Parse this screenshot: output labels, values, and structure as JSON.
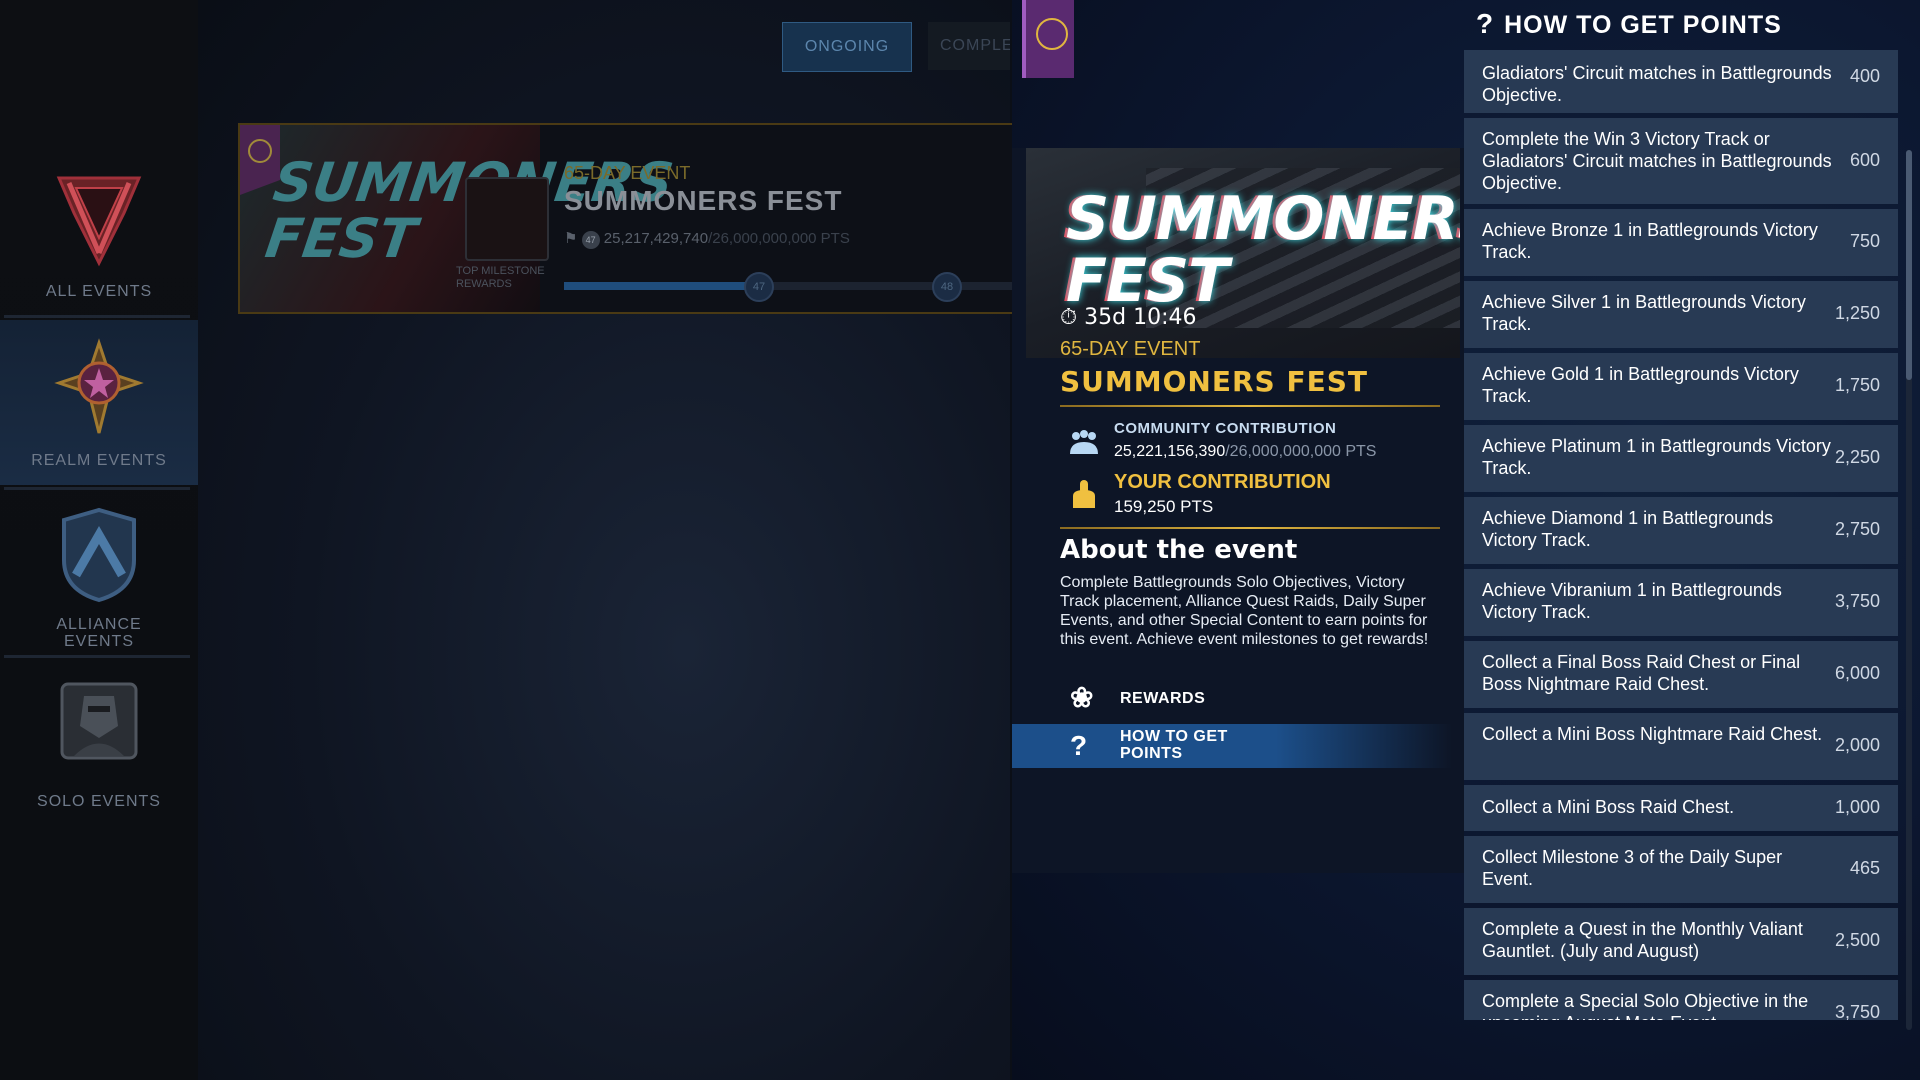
{
  "sidebar": {
    "items": [
      {
        "label": "ALL EVENTS",
        "icon": "all-events-icon"
      },
      {
        "label": "REALM EVENTS",
        "icon": "realm-events-icon"
      },
      {
        "label": "ALLIANCE EVENTS",
        "icon": "alliance-events-icon"
      },
      {
        "label": "SOLO EVENTS",
        "icon": "solo-events-icon"
      }
    ]
  },
  "tabs": {
    "ongoing": "ONGOING",
    "completed": "COMPLE"
  },
  "event_card": {
    "art_text": "SUMMONERS FEST",
    "type": "65-DAY EVENT",
    "title": "SUMMONERS FEST",
    "badge": "47",
    "points": "25,217,429,740",
    "points_max": "/26,000,000,000 PTS",
    "milestone_label": "TOP MILESTONE REWARDS",
    "progress": 0.44,
    "node_a": "47",
    "node_b": "48"
  },
  "detail": {
    "hero_text": "SUMMONERS FEST",
    "timer": "35d 10:46",
    "type": "65-DAY EVENT",
    "title": "SUMMONERS FEST",
    "community_label": "COMMUNITY CONTRIBUTION",
    "community_value": "25,221,156,390",
    "community_max": "/26,000,000,000 PTS",
    "your_label": "YOUR CONTRIBUTION",
    "your_value": "159,250 PTS",
    "about_title": "About the event",
    "about_text": "Complete Battlegrounds Solo Objectives, Victory Track placement, Alliance Quest Raids, Daily Super Events, and other Special Content to earn points for this event. Achieve event milestones to get rewards!",
    "nav_rewards": "REWARDS",
    "nav_htp": "HOW TO GET POINTS"
  },
  "how_to_get_points": {
    "title": "HOW TO GET POINTS",
    "rows": [
      {
        "desc": "Gladiators' Circuit matches in Battlegrounds Objective.",
        "pts": "400"
      },
      {
        "desc": "Complete the Win 3 Victory Track or Gladiators' Circuit matches in Battlegrounds Objective.",
        "pts": "600"
      },
      {
        "desc": "Achieve Bronze 1 in Battlegrounds Victory Track.",
        "pts": "750"
      },
      {
        "desc": "Achieve Silver 1 in Battlegrounds Victory Track.",
        "pts": "1,250"
      },
      {
        "desc": "Achieve Gold 1 in Battlegrounds Victory Track.",
        "pts": "1,750"
      },
      {
        "desc": "Achieve Platinum 1 in Battlegrounds Victory Track.",
        "pts": "2,250"
      },
      {
        "desc": "Achieve Diamond 1 in Battlegrounds Victory Track.",
        "pts": "2,750"
      },
      {
        "desc": "Achieve Vibranium 1 in Battlegrounds Victory Track.",
        "pts": "3,750"
      },
      {
        "desc": "Collect a Final Boss Raid Chest or Final Boss Nightmare Raid Chest.",
        "pts": "6,000"
      },
      {
        "desc": "Collect a Mini Boss Nightmare Raid Chest.",
        "pts": "2,000"
      },
      {
        "desc": "Collect a Mini Boss Raid Chest.",
        "pts": "1,000"
      },
      {
        "desc": "Collect Milestone 3 of the Daily Super Event.",
        "pts": "465"
      },
      {
        "desc": "Complete a Quest in the Monthly Valiant Gauntlet. (July and August)",
        "pts": "2,500"
      },
      {
        "desc": "Complete a Special Solo Objective in the upcoming August Meta Event.",
        "pts": "3,750"
      }
    ]
  }
}
